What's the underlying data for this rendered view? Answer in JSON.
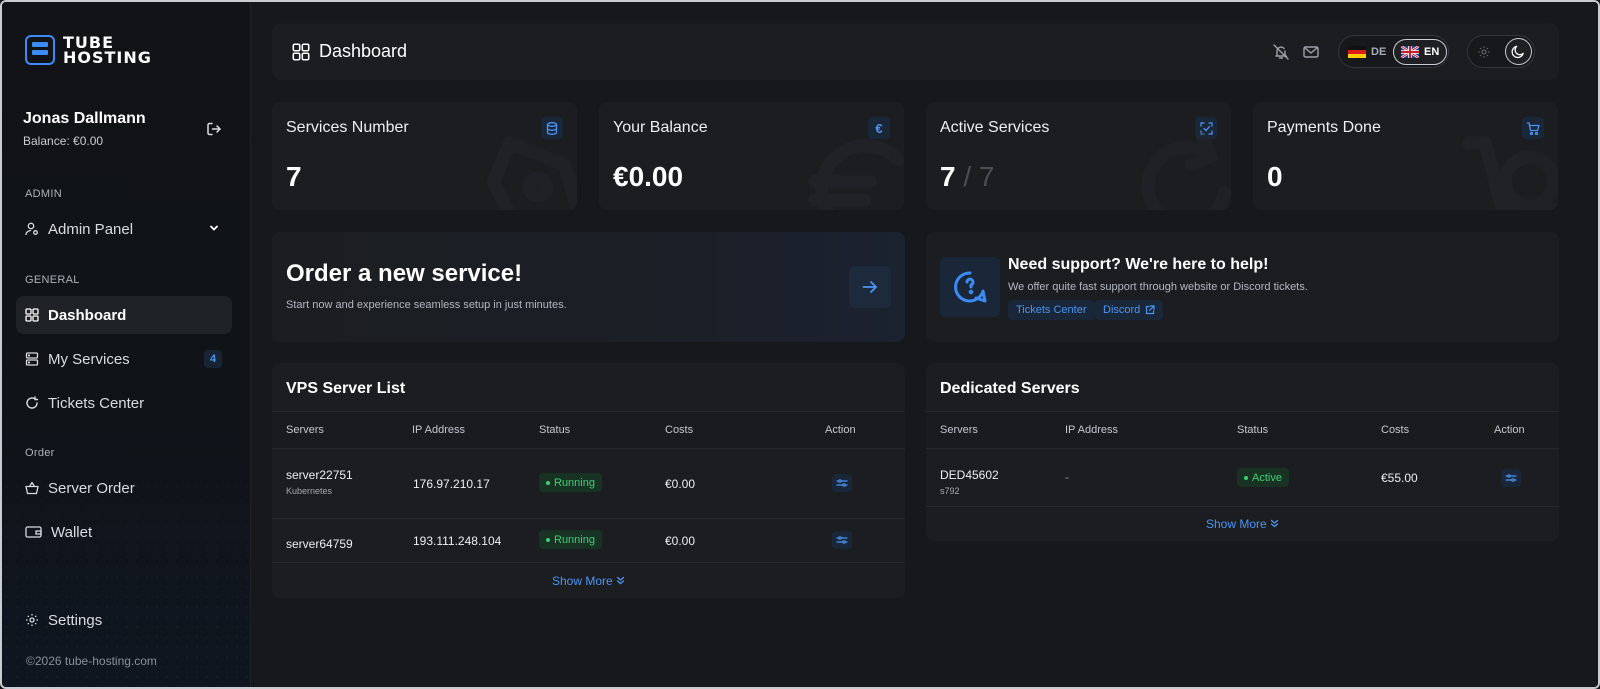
{
  "brand": {
    "line1": "TUBE",
    "line2": "HOSTING"
  },
  "user": {
    "name": "Jonas Dallmann",
    "balance": "Balance: €0.00"
  },
  "sidebar": {
    "sections": {
      "admin": "ADMIN",
      "general": "GENERAL",
      "order": "Order"
    },
    "items": {
      "admin_panel": "Admin Panel",
      "dashboard": "Dashboard",
      "my_services": "My Services",
      "my_services_count": "4",
      "tickets_center": "Tickets Center",
      "server_order": "Server Order",
      "wallet": "Wallet",
      "settings": "Settings"
    },
    "footer": "©2026 tube-hosting.com"
  },
  "header": {
    "title": "Dashboard",
    "lang_de": "DE",
    "lang_en": "EN"
  },
  "stats": [
    {
      "title": "Services Number",
      "value": "7"
    },
    {
      "title": "Your Balance",
      "value": "€0.00"
    },
    {
      "title": "Active Services",
      "value": "7",
      "value_total": "/ 7"
    },
    {
      "title": "Payments Done",
      "value": "0"
    }
  ],
  "order": {
    "title": "Order a new service!",
    "subtitle": "Start now and experience seamless setup in just minutes."
  },
  "support": {
    "title": "Need support? We're here to help!",
    "subtitle": "We offer quite fast support through website or Discord tickets.",
    "tickets_btn": "Tickets Center",
    "discord_btn": "Discord"
  },
  "vps": {
    "title": "VPS Server List",
    "columns": [
      "Servers",
      "IP Address",
      "Status",
      "Costs",
      "Action"
    ],
    "rows": [
      {
        "name": "server22751",
        "sub": "Kubernetes",
        "ip": "176.97.210.17",
        "status": "Running",
        "cost": "€0.00"
      },
      {
        "name": "server64759",
        "sub": "",
        "ip": "193.111.248.104",
        "status": "Running",
        "cost": "€0.00"
      }
    ],
    "show_more": "Show More"
  },
  "dedicated": {
    "title": "Dedicated Servers",
    "columns": [
      "Servers",
      "IP Address",
      "Status",
      "Costs",
      "Action"
    ],
    "rows": [
      {
        "name": "DED45602",
        "sub": "s792",
        "ip": "-",
        "status": "Active",
        "cost": "€55.00"
      }
    ],
    "show_more": "Show More"
  },
  "colors": {
    "accent": "#3b8cf7",
    "success": "#3ccf73",
    "card": "#1b1d21",
    "bg": "#16181c"
  }
}
